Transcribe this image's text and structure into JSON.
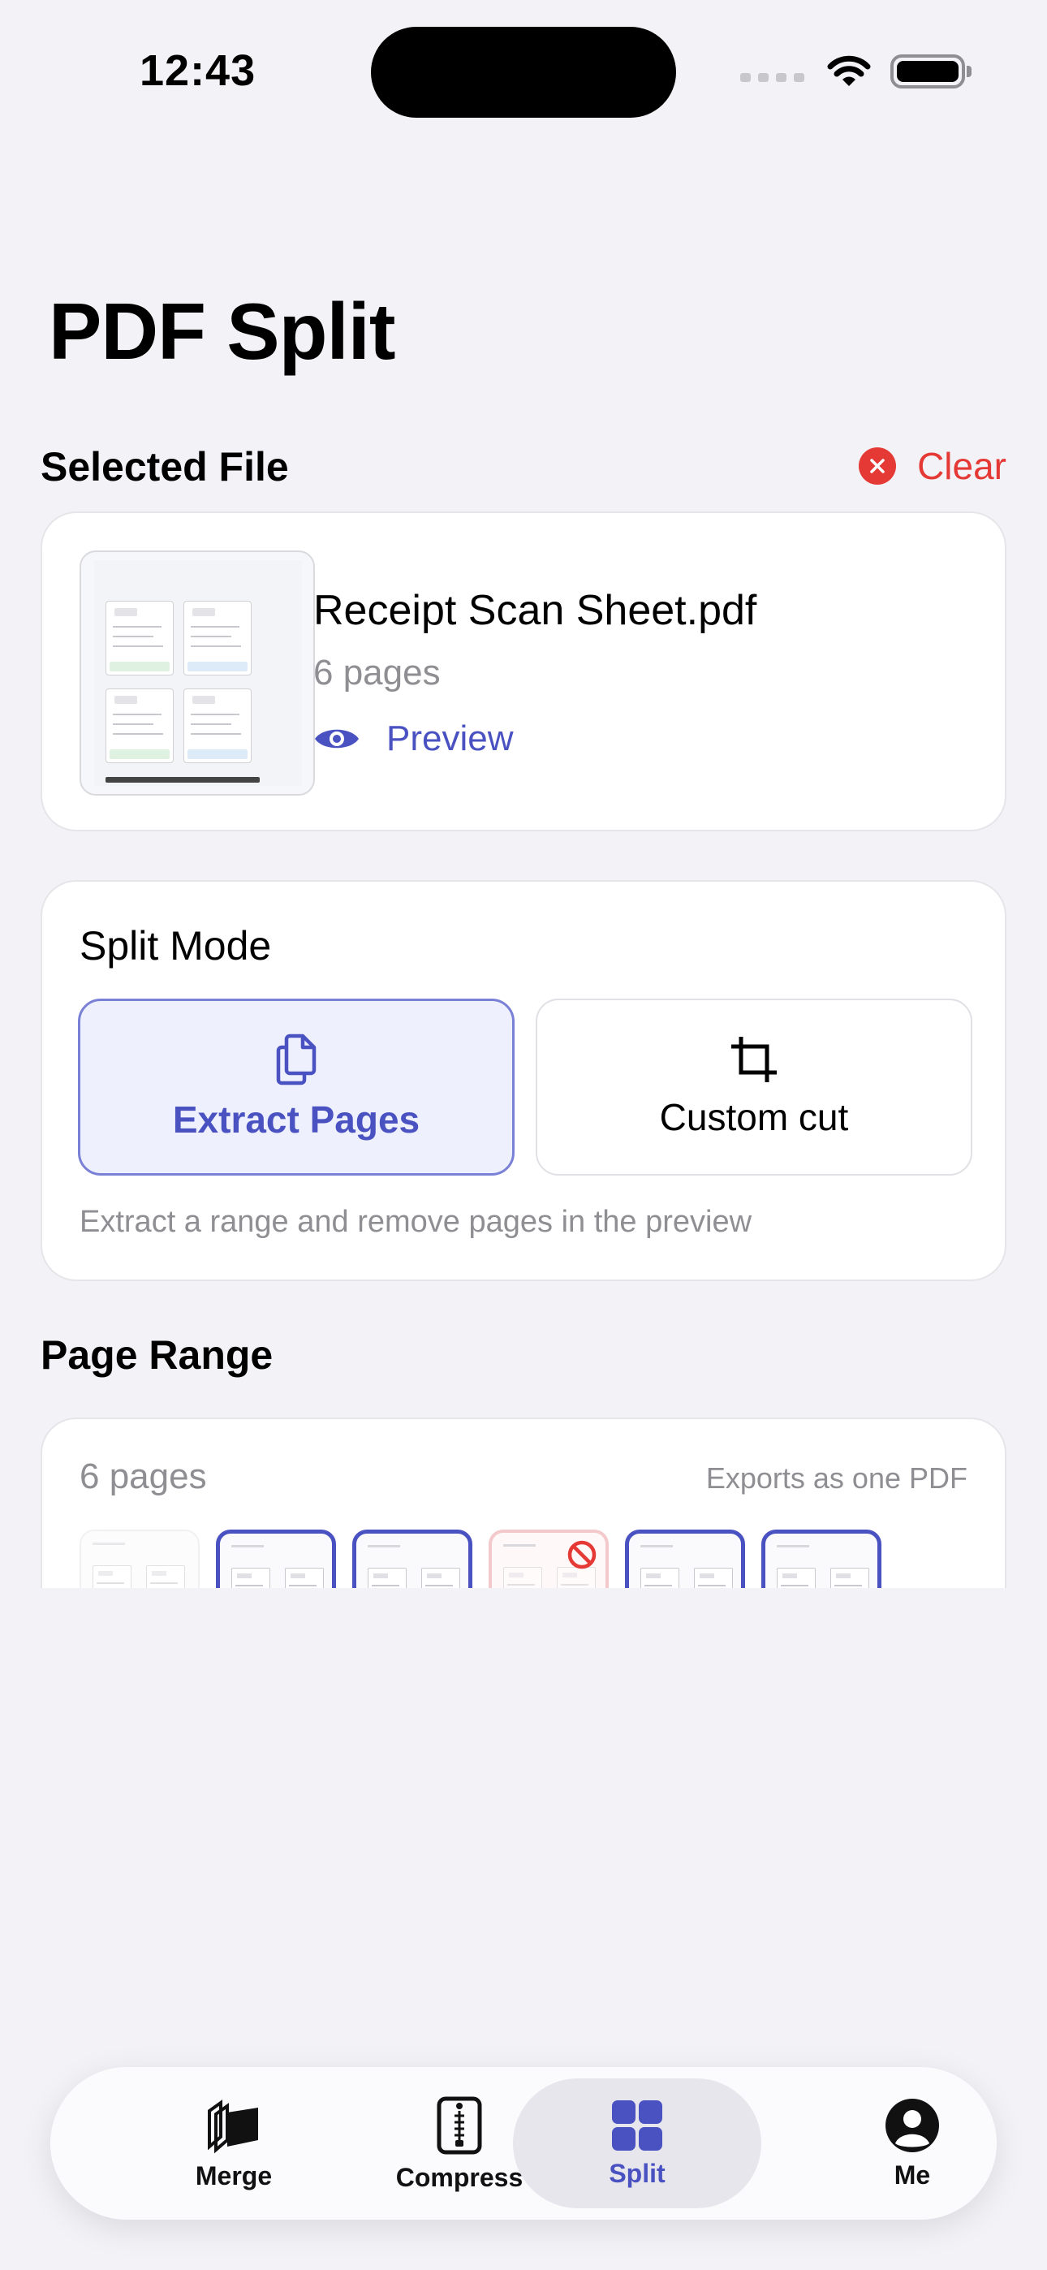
{
  "status_bar": {
    "time": "12:43"
  },
  "header": {
    "title": "PDF Split"
  },
  "selected_file": {
    "section_label": "Selected File",
    "clear_label": "Clear",
    "file_name": "Receipt Scan Sheet.pdf",
    "pages_text": "6  pages",
    "preview_label": "Preview"
  },
  "split_mode": {
    "heading": "Split Mode",
    "options": [
      {
        "label": "Extract Pages",
        "icon": "documents-icon",
        "selected": true
      },
      {
        "label": "Custom cut",
        "icon": "crop-icon",
        "selected": false
      }
    ],
    "description": "Extract a range and remove pages in the preview"
  },
  "page_range": {
    "section_label": "Page Range",
    "count_text": "6 pages",
    "note": "Exports as one PDF",
    "pages": [
      {
        "state": "unselected"
      },
      {
        "state": "selected"
      },
      {
        "state": "selected"
      },
      {
        "state": "removed"
      },
      {
        "state": "selected"
      },
      {
        "state": "selected"
      }
    ]
  },
  "tab_bar": {
    "tabs": [
      {
        "label": "Merge",
        "icon": "books-icon",
        "active": false
      },
      {
        "label": "Compress",
        "icon": "zip-file-icon",
        "active": false
      },
      {
        "label": "Split",
        "icon": "grid-icon",
        "active": true
      },
      {
        "label": "Me",
        "icon": "person-icon",
        "active": false
      }
    ]
  },
  "colors": {
    "accent": "#4a52c2",
    "destructive": "#e53935",
    "background": "#f2f2f7"
  }
}
